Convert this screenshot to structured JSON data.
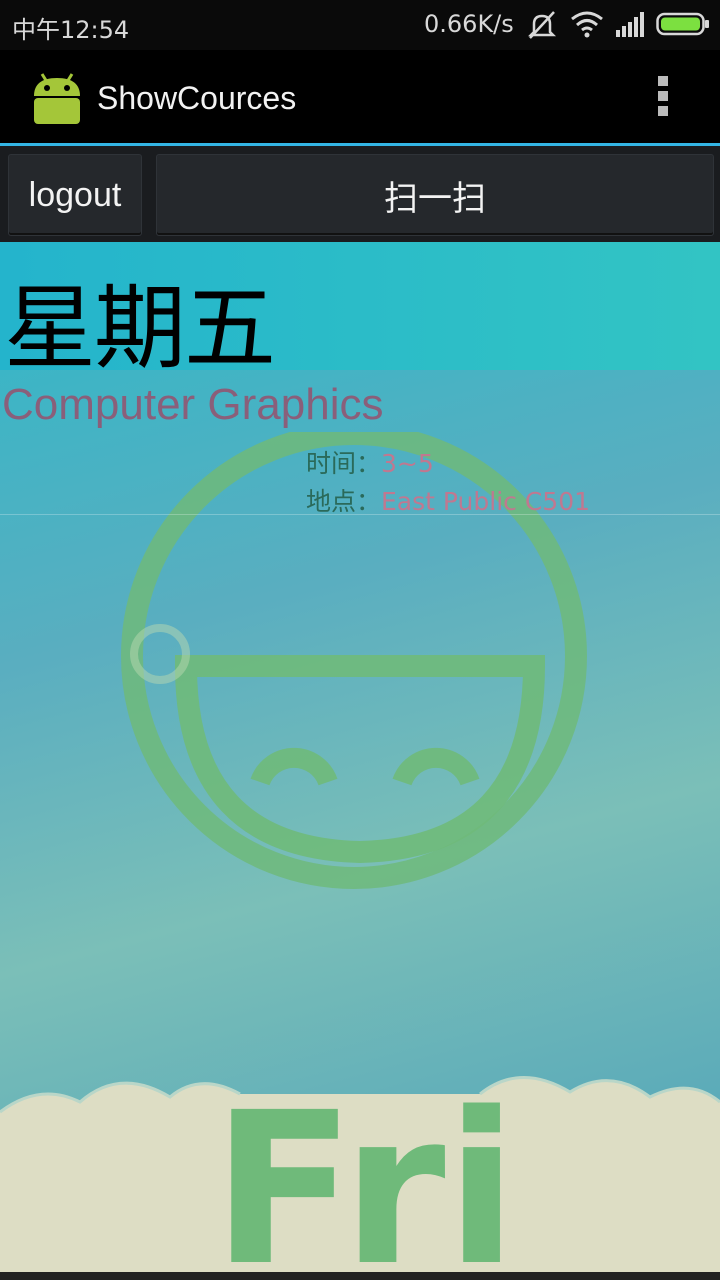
{
  "status_bar": {
    "time": "中午12:54",
    "network_speed": "0.66K/s",
    "icons": [
      "mute-icon",
      "wifi-icon",
      "signal-icon",
      "battery-icon"
    ]
  },
  "action_bar": {
    "app_icon": "android-robot-icon",
    "title": "ShowCources",
    "overflow_icon": "overflow-menu-icon"
  },
  "buttons": {
    "logout_label": "logout",
    "scan_label": "扫一扫"
  },
  "schedule": {
    "day": "星期五",
    "course": {
      "name": "Computer Graphics",
      "time_label": "时间：",
      "time_value": "3~5",
      "place_label": "地点：",
      "place_value": "East Public C501"
    },
    "background_text": "Fri"
  },
  "colors": {
    "accent": "#33b5e5",
    "course_name": "#8a5f7a",
    "label": "#2a6a5a",
    "value": "#c07890",
    "smiley": "#6fba7a"
  }
}
